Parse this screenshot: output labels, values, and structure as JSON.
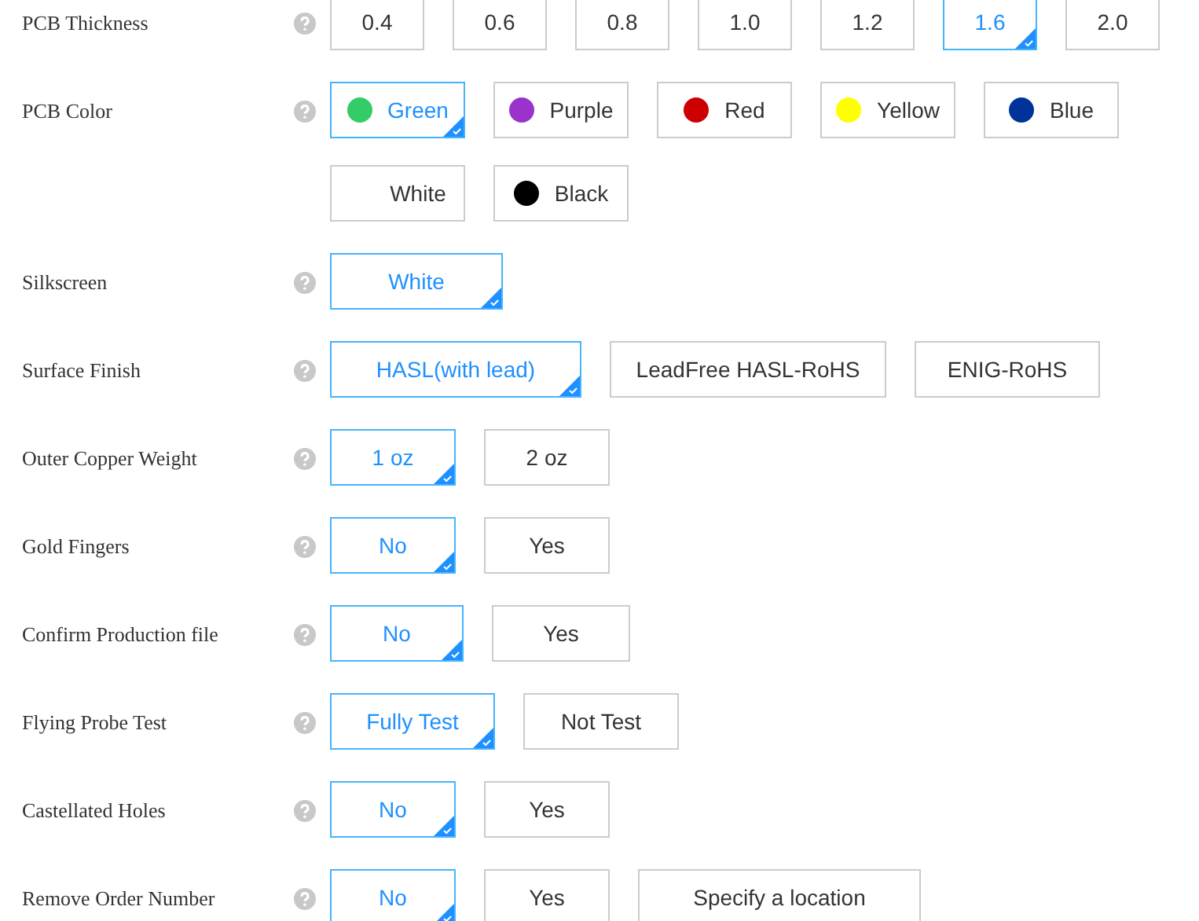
{
  "options": [
    {
      "label": "PCB Thickness",
      "choices": [
        {
          "text": "0.4",
          "selected": false
        },
        {
          "text": "0.6",
          "selected": false
        },
        {
          "text": "0.8",
          "selected": false
        },
        {
          "text": "1.0",
          "selected": false
        },
        {
          "text": "1.2",
          "selected": false
        },
        {
          "text": "1.6",
          "selected": true
        },
        {
          "text": "2.0",
          "selected": false
        }
      ]
    },
    {
      "label": "PCB Color",
      "choices": [
        {
          "text": "Green",
          "selected": true,
          "color": "#33cc66"
        },
        {
          "text": "Purple",
          "selected": false,
          "color": "#9933cc"
        },
        {
          "text": "Red",
          "selected": false,
          "color": "#cc0000"
        },
        {
          "text": "Yellow",
          "selected": false,
          "color": "#ffff00"
        },
        {
          "text": "Blue",
          "selected": false,
          "color": "#003399"
        },
        {
          "text": "White",
          "selected": false,
          "color": "#ffffff"
        },
        {
          "text": "Black",
          "selected": false,
          "color": "#000000"
        }
      ]
    },
    {
      "label": "Silkscreen",
      "choices": [
        {
          "text": "White",
          "selected": true
        }
      ]
    },
    {
      "label": "Surface Finish",
      "choices": [
        {
          "text": "HASL(with lead)",
          "selected": true
        },
        {
          "text": "LeadFree HASL-RoHS",
          "selected": false
        },
        {
          "text": "ENIG-RoHS",
          "selected": false
        }
      ]
    },
    {
      "label": "Outer Copper Weight",
      "choices": [
        {
          "text": "1 oz",
          "selected": true
        },
        {
          "text": "2 oz",
          "selected": false
        }
      ]
    },
    {
      "label": "Gold Fingers",
      "choices": [
        {
          "text": "No",
          "selected": true
        },
        {
          "text": "Yes",
          "selected": false
        }
      ]
    },
    {
      "label": "Confirm Production file",
      "choices": [
        {
          "text": "No",
          "selected": true
        },
        {
          "text": "Yes",
          "selected": false
        }
      ]
    },
    {
      "label": "Flying Probe Test",
      "choices": [
        {
          "text": "Fully Test",
          "selected": true
        },
        {
          "text": "Not Test",
          "selected": false
        }
      ]
    },
    {
      "label": "Castellated Holes",
      "choices": [
        {
          "text": "No",
          "selected": true
        },
        {
          "text": "Yes",
          "selected": false
        }
      ]
    },
    {
      "label": "Remove Order Number",
      "choices": [
        {
          "text": "No",
          "selected": true
        },
        {
          "text": "Yes",
          "selected": false
        },
        {
          "text": "Specify a location",
          "selected": false
        }
      ]
    }
  ]
}
